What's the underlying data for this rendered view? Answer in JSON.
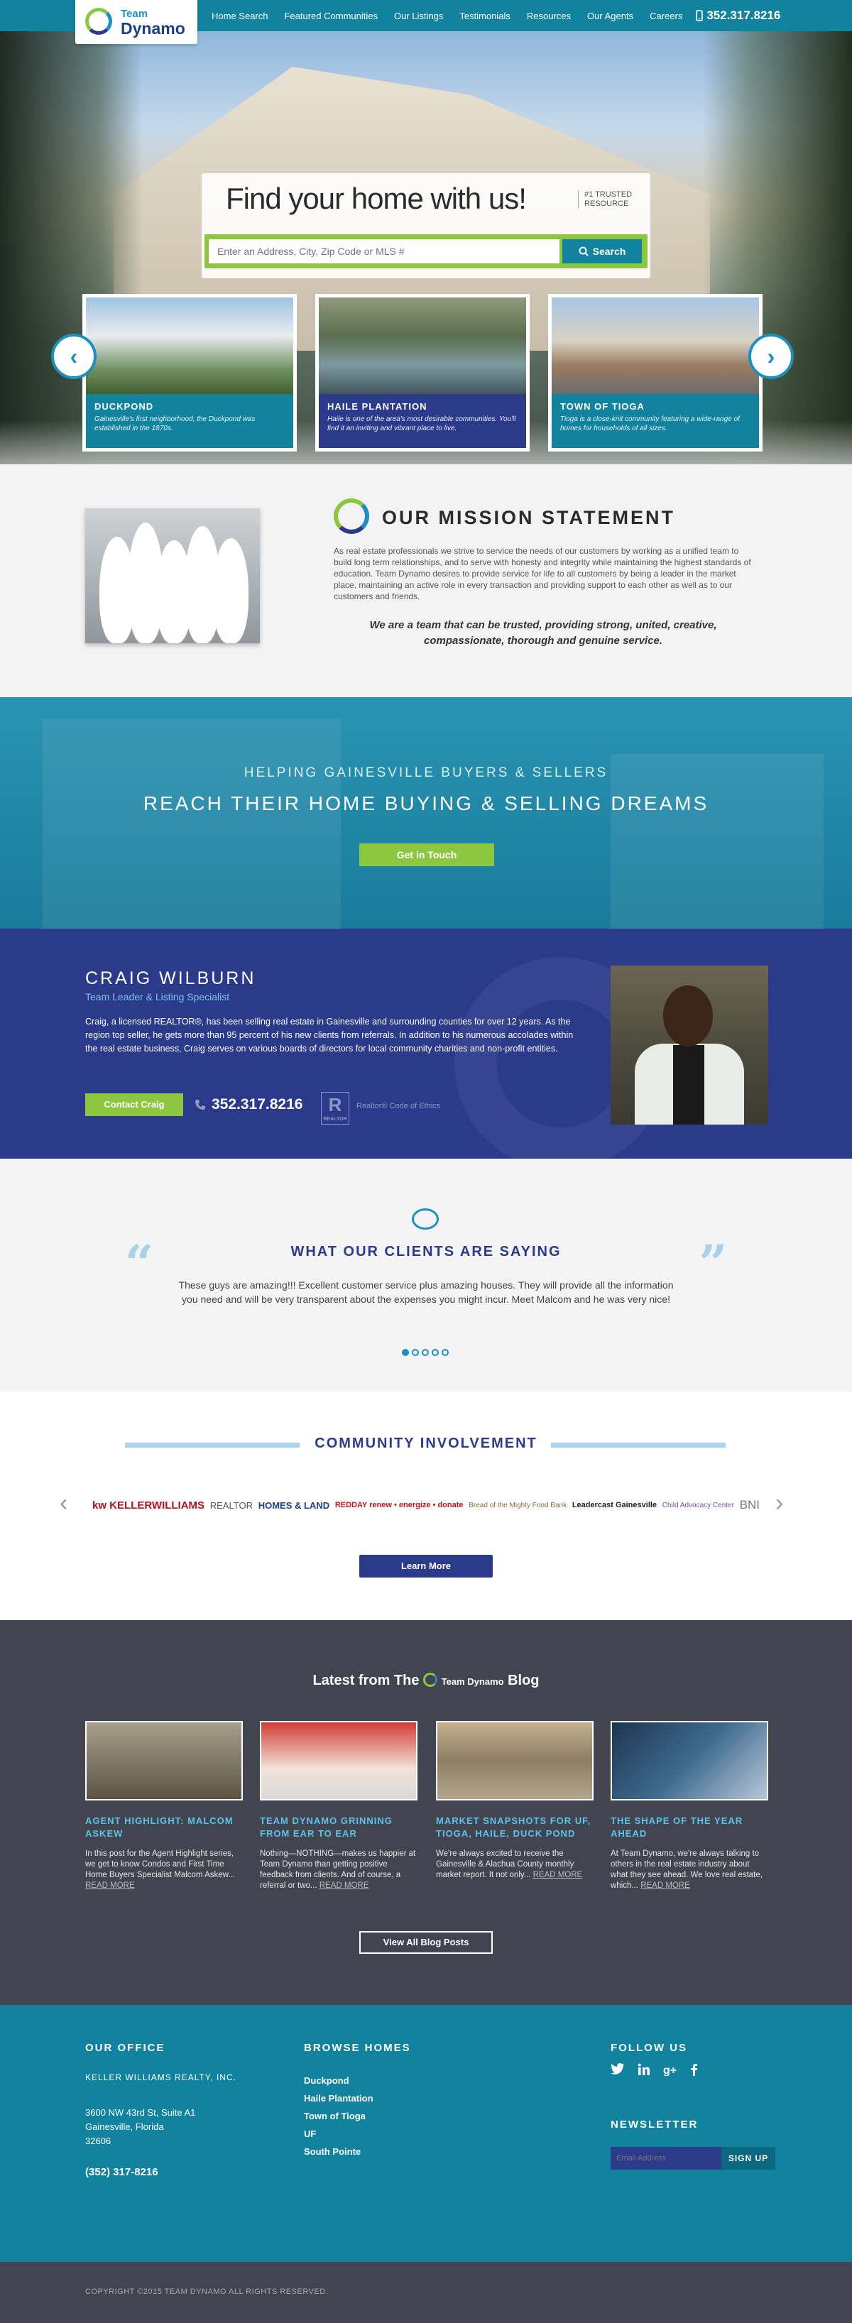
{
  "header": {
    "logo_line1": "Team",
    "logo_line2": "Dynamo",
    "nav": [
      "Home Search",
      "Featured Communities",
      "Our Listings",
      "Testimonials",
      "Resources",
      "Our Agents",
      "Careers"
    ],
    "phone": "352.317.8216"
  },
  "hero": {
    "headline": "Find your home with us!",
    "trusted": "#1 TRUSTED RESOURCE",
    "search_placeholder": "Enter an Address, City, Zip Code or MLS #",
    "search_button": "Search"
  },
  "communities": [
    {
      "name": "DUCKPOND",
      "desc": "Gainesville's first neighborhood, the Duckpond was established in the 1870s."
    },
    {
      "name": "HAILE PLANTATION",
      "desc": "Haile is one of the area's most desirable communities. You'll find it an inviting and vibrant place to live."
    },
    {
      "name": "TOWN OF TIOGA",
      "desc": "Tioga is a close-knit community featuring a wide-range of homes for households of all sizes."
    }
  ],
  "mission": {
    "title": "OUR MISSION STATEMENT",
    "body": "As real estate professionals we strive to service the needs of our customers by working as a unified team to build long term relationships, and to serve with honesty and integrity while maintaining the highest standards of education. Team Dynamo desires to provide service for life to all customers by being a leader in the market place, maintaining an active role in every transaction and providing support to each other as well as to our customers and friends.",
    "quote": "We are a team that can be trusted, providing strong, united, creative, compassionate, thorough and genuine service."
  },
  "buyers": {
    "subtitle": "HELPING GAINESVILLE BUYERS & SELLERS",
    "title": "REACH THEIR HOME BUYING & SELLING DREAMS",
    "button": "Get in Touch"
  },
  "agent": {
    "name": "CRAIG WILBURN",
    "role": "Team Leader & Listing Specialist",
    "bio": "Craig, a licensed REALTOR®, has been selling real estate in Gainesville and surrounding counties for over 12 years. As the region top seller, he gets more than 95 percent of his new clients from referrals. In addition to his numerous accolades within the real estate business, Craig serves on various boards of directors for local community charities and non-profit entities.",
    "button": "Contact Craig",
    "phone": "352.317.8216",
    "realtor_mark": "R",
    "realtor_small": "REALTOR",
    "ethics": "Realtor® Code of Ethics"
  },
  "testimonials": {
    "title": "WHAT OUR CLIENTS ARE SAYING",
    "quote": "These guys are amazing!!! Excellent customer service plus amazing houses. They will provide all the information you need and will be very transparent about the expenses you might incur. Meet Malcom and he was very nice!",
    "open_quote": "“",
    "close_quote": "”"
  },
  "community": {
    "title": "COMMUNITY INVOLVEMENT",
    "logos": [
      "kw KELLERWILLIAMS",
      "REALTOR",
      "HOMES & LAND",
      "REDDAY renew • energize • donate",
      "Bread of the Mighty Food Bank",
      "Leadercast Gainesville",
      "Child Advocacy Center",
      "BNI"
    ],
    "button": "Learn More"
  },
  "blog": {
    "title_prefix": "Latest from The",
    "title_brand": "Team Dynamo",
    "title_suffix": "Blog",
    "posts": [
      {
        "title": "AGENT HIGHLIGHT: MALCOM ASKEW",
        "excerpt": "In this post for the Agent Highlight series, we get to know Condos and First Time Home Buyers Specialist Malcom Askew...",
        "read_more": "READ MORE"
      },
      {
        "title": "TEAM DYNAMO GRINNING FROM EAR TO EAR",
        "excerpt": "Nothing—NOTHING—makes us happier at Team Dynamo than getting positive feedback from clients. And of course, a referral or two...",
        "read_more": "READ MORE"
      },
      {
        "title": "MARKET SNAPSHOTS FOR UF, TIOGA, HAILE, DUCK POND",
        "excerpt": "We're always excited to receive the Gainesville & Alachua County monthly market report. It not only...",
        "read_more": "READ MORE"
      },
      {
        "title": "THE SHAPE OF THE YEAR AHEAD",
        "excerpt": "At Team Dynamo, we're always talking to others in the real estate industry about what they see ahead. We love real estate, which...",
        "read_more": "READ MORE"
      }
    ],
    "button": "View All Blog Posts"
  },
  "footer": {
    "office_title": "OUR OFFICE",
    "company": "KELLER WILLIAMS REALTY, INC.",
    "address1": "3600 NW 43rd St, Suite A1",
    "address2": "Gainesville, Florida",
    "zip": "32606",
    "phone": "(352) 317-8216",
    "browse_title": "BROWSE HOMES",
    "browse": [
      "Duckpond",
      "Haile Plantation",
      "Town of Tioga",
      "UF",
      "South Pointe"
    ],
    "follow_title": "FOLLOW US",
    "newsletter_title": "NEWSLETTER",
    "email_placeholder": "Email Address",
    "signup": "SIGN UP",
    "copyright": "COPYRIGHT ©2015 TEAM DYNAMO ALL RIGHTS RESERVED."
  }
}
